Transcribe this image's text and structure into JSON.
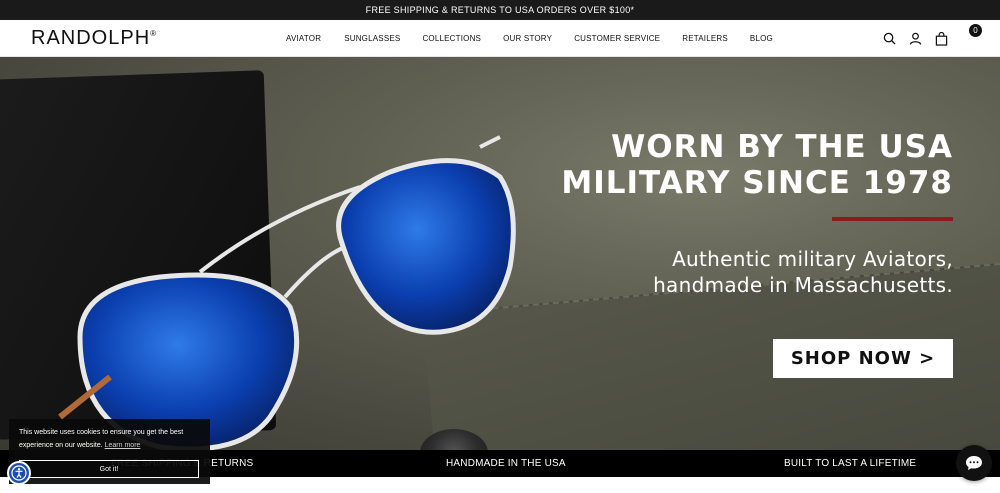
{
  "announcement": "FREE SHIPPING & RETURNS TO USA ORDERS OVER $100*",
  "brand": {
    "name": "RANDOLPH",
    "mark": "®"
  },
  "nav": {
    "items": [
      "AVIATOR",
      "SUNGLASSES",
      "COLLECTIONS",
      "OUR STORY",
      "CUSTOMER SERVICE",
      "RETAILERS",
      "BLOG"
    ]
  },
  "header_icons": {
    "search": "search-icon",
    "account": "user-icon",
    "cart": "shopping-bag-icon",
    "cart_count": "0"
  },
  "hero": {
    "title_line1": "WORN BY THE USA",
    "title_line2": "MILITARY SINCE 1978",
    "sub_line1": "Authentic military Aviators,",
    "sub_line2": "handmade in Massachusetts.",
    "cta": "SHOP NOW >",
    "accent": "#8a1c1c"
  },
  "features": [
    "FREE SHIPPING & RETURNS",
    "HANDMADE IN THE USA",
    "BUILT TO LAST A LIFETIME"
  ],
  "cookie": {
    "text": "This website uses cookies to ensure you get the best experience on our website.",
    "link": "Learn more",
    "button": "Got it!"
  },
  "widgets": {
    "accessibility": "accessibility-icon",
    "chat": "chat-icon"
  }
}
